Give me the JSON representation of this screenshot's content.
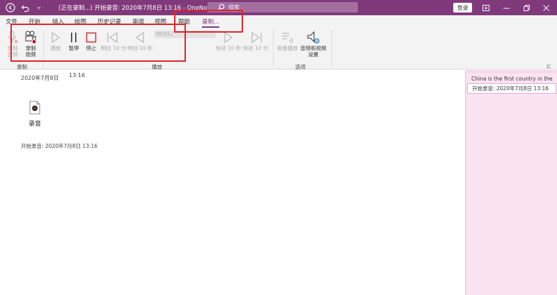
{
  "titlebar": {
    "doc_title": "(正在录制...) 开始录音: 2020年7月8日 13:16  -  OneNote",
    "search_placeholder": "搜索",
    "login_label": "登录",
    "back_icon": "back-icon",
    "undo_icon": "undo-icon",
    "quick_access_icon": "chevron-down-icon"
  },
  "tabs": [
    {
      "label": "文件"
    },
    {
      "label": "开始"
    },
    {
      "label": "插入"
    },
    {
      "label": "绘图"
    },
    {
      "label": "历史记录"
    },
    {
      "label": "审阅"
    },
    {
      "label": "视图"
    },
    {
      "label": "帮助"
    },
    {
      "label": "录制..."
    }
  ],
  "ribbon": {
    "record_group": {
      "label": "录制",
      "record_audio": "录制\n音频",
      "record_video": "录制\n视频"
    },
    "playback_group": {
      "label": "播放",
      "play": "播放",
      "pause": "暂停",
      "stop": "停止",
      "rewind_10min": "倒回 10 分",
      "rewind_10sec": "倒回 10 秒",
      "time": "00:01 / ",
      "forward_10sec": "快进 10 秒",
      "forward_10min": "快进 10 分"
    },
    "options_group": {
      "label": "选项",
      "see_playback": "观看播放",
      "av_settings": "音频和视频\n设置"
    }
  },
  "page": {
    "date": "2020年7月8日",
    "time": "13:16",
    "audio_label": "录音",
    "recording_start": "开始录音: 2020年7月8日 13:16"
  },
  "side_pane": {
    "text": "China is the first country in the",
    "box_text": "开始录音: 2020年7月8日 13:16"
  },
  "colors": {
    "brand": "#80397b",
    "highlight": "#e2232a",
    "side_pane_bg": "#fbe4f2"
  }
}
